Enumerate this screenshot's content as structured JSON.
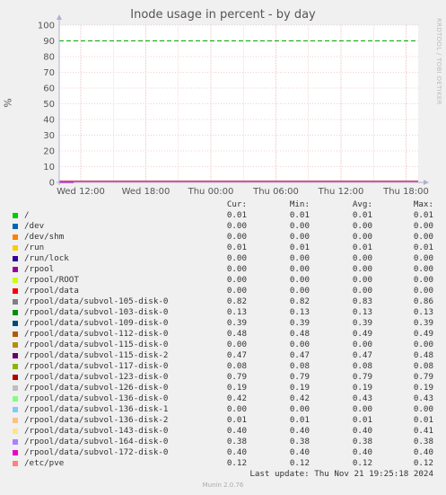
{
  "chart_data": {
    "type": "line",
    "title": "Inode usage in percent - by day",
    "ylabel": "%",
    "ylim": [
      0,
      100
    ],
    "yticks": [
      0,
      10,
      20,
      30,
      40,
      50,
      60,
      70,
      80,
      90,
      100
    ],
    "xticks": [
      "Wed 12:00",
      "Wed 18:00",
      "Thu 00:00",
      "Thu 06:00",
      "Thu 12:00",
      "Thu 18:00"
    ],
    "warning_line": 90,
    "grid": true,
    "legend_columns": [
      "Cur:",
      "Min:",
      "Avg:",
      "Max:"
    ],
    "series": [
      {
        "name": "/",
        "color": "#00cc00",
        "cur": "0.01",
        "min": "0.01",
        "avg": "0.01",
        "max": "0.01"
      },
      {
        "name": "/dev",
        "color": "#0066b3",
        "cur": "0.00",
        "min": "0.00",
        "avg": "0.00",
        "max": "0.00"
      },
      {
        "name": "/dev/shm",
        "color": "#ff8000",
        "cur": "0.00",
        "min": "0.00",
        "avg": "0.00",
        "max": "0.00"
      },
      {
        "name": "/run",
        "color": "#ffcc00",
        "cur": "0.01",
        "min": "0.01",
        "avg": "0.01",
        "max": "0.01"
      },
      {
        "name": "/run/lock",
        "color": "#330099",
        "cur": "0.00",
        "min": "0.00",
        "avg": "0.00",
        "max": "0.00"
      },
      {
        "name": "/rpool",
        "color": "#990099",
        "cur": "0.00",
        "min": "0.00",
        "avg": "0.00",
        "max": "0.00"
      },
      {
        "name": "/rpool/ROOT",
        "color": "#ccff00",
        "cur": "0.00",
        "min": "0.00",
        "avg": "0.00",
        "max": "0.00"
      },
      {
        "name": "/rpool/data",
        "color": "#ff0000",
        "cur": "0.00",
        "min": "0.00",
        "avg": "0.00",
        "max": "0.00"
      },
      {
        "name": "/rpool/data/subvol-105-disk-0",
        "color": "#808080",
        "cur": "0.82",
        "min": "0.82",
        "avg": "0.83",
        "max": "0.86"
      },
      {
        "name": "/rpool/data/subvol-103-disk-0",
        "color": "#008f00",
        "cur": "0.13",
        "min": "0.13",
        "avg": "0.13",
        "max": "0.13"
      },
      {
        "name": "/rpool/data/subvol-109-disk-0",
        "color": "#00487d",
        "cur": "0.39",
        "min": "0.39",
        "avg": "0.39",
        "max": "0.39"
      },
      {
        "name": "/rpool/data/subvol-112-disk-0",
        "color": "#b35a00",
        "cur": "0.48",
        "min": "0.48",
        "avg": "0.49",
        "max": "0.49"
      },
      {
        "name": "/rpool/data/subvol-115-disk-0",
        "color": "#b38f00",
        "cur": "0.00",
        "min": "0.00",
        "avg": "0.00",
        "max": "0.00"
      },
      {
        "name": "/rpool/data/subvol-115-disk-2",
        "color": "#6b006b",
        "cur": "0.47",
        "min": "0.47",
        "avg": "0.47",
        "max": "0.48"
      },
      {
        "name": "/rpool/data/subvol-117-disk-0",
        "color": "#8fb300",
        "cur": "0.08",
        "min": "0.08",
        "avg": "0.08",
        "max": "0.08"
      },
      {
        "name": "/rpool/data/subvol-123-disk-0",
        "color": "#b30000",
        "cur": "0.79",
        "min": "0.79",
        "avg": "0.79",
        "max": "0.79"
      },
      {
        "name": "/rpool/data/subvol-126-disk-0",
        "color": "#bebebe",
        "cur": "0.19",
        "min": "0.19",
        "avg": "0.19",
        "max": "0.19"
      },
      {
        "name": "/rpool/data/subvol-136-disk-0",
        "color": "#80ff80",
        "cur": "0.42",
        "min": "0.42",
        "avg": "0.43",
        "max": "0.43"
      },
      {
        "name": "/rpool/data/subvol-136-disk-1",
        "color": "#80c9ff",
        "cur": "0.00",
        "min": "0.00",
        "avg": "0.00",
        "max": "0.00"
      },
      {
        "name": "/rpool/data/subvol-136-disk-2",
        "color": "#ffc080",
        "cur": "0.01",
        "min": "0.01",
        "avg": "0.01",
        "max": "0.01"
      },
      {
        "name": "/rpool/data/subvol-143-disk-0",
        "color": "#ffe680",
        "cur": "0.40",
        "min": "0.40",
        "avg": "0.40",
        "max": "0.41"
      },
      {
        "name": "/rpool/data/subvol-164-disk-0",
        "color": "#aa80ff",
        "cur": "0.38",
        "min": "0.38",
        "avg": "0.38",
        "max": "0.38"
      },
      {
        "name": "/rpool/data/subvol-172-disk-0",
        "color": "#ee00cc",
        "cur": "0.40",
        "min": "0.40",
        "avg": "0.40",
        "max": "0.40"
      },
      {
        "name": "/etc/pve",
        "color": "#ff8080",
        "cur": "0.12",
        "min": "0.12",
        "avg": "0.12",
        "max": "0.12"
      }
    ]
  },
  "side_label": "RRDTOOL / TOBI OETIKER",
  "last_update": "Last update: Thu Nov 21 19:25:18 2024",
  "version": "Munin 2.0.76",
  "colors": {
    "grid": "#e8a0a0",
    "warning": "#00aa00",
    "axis": "#b0b0d0"
  }
}
